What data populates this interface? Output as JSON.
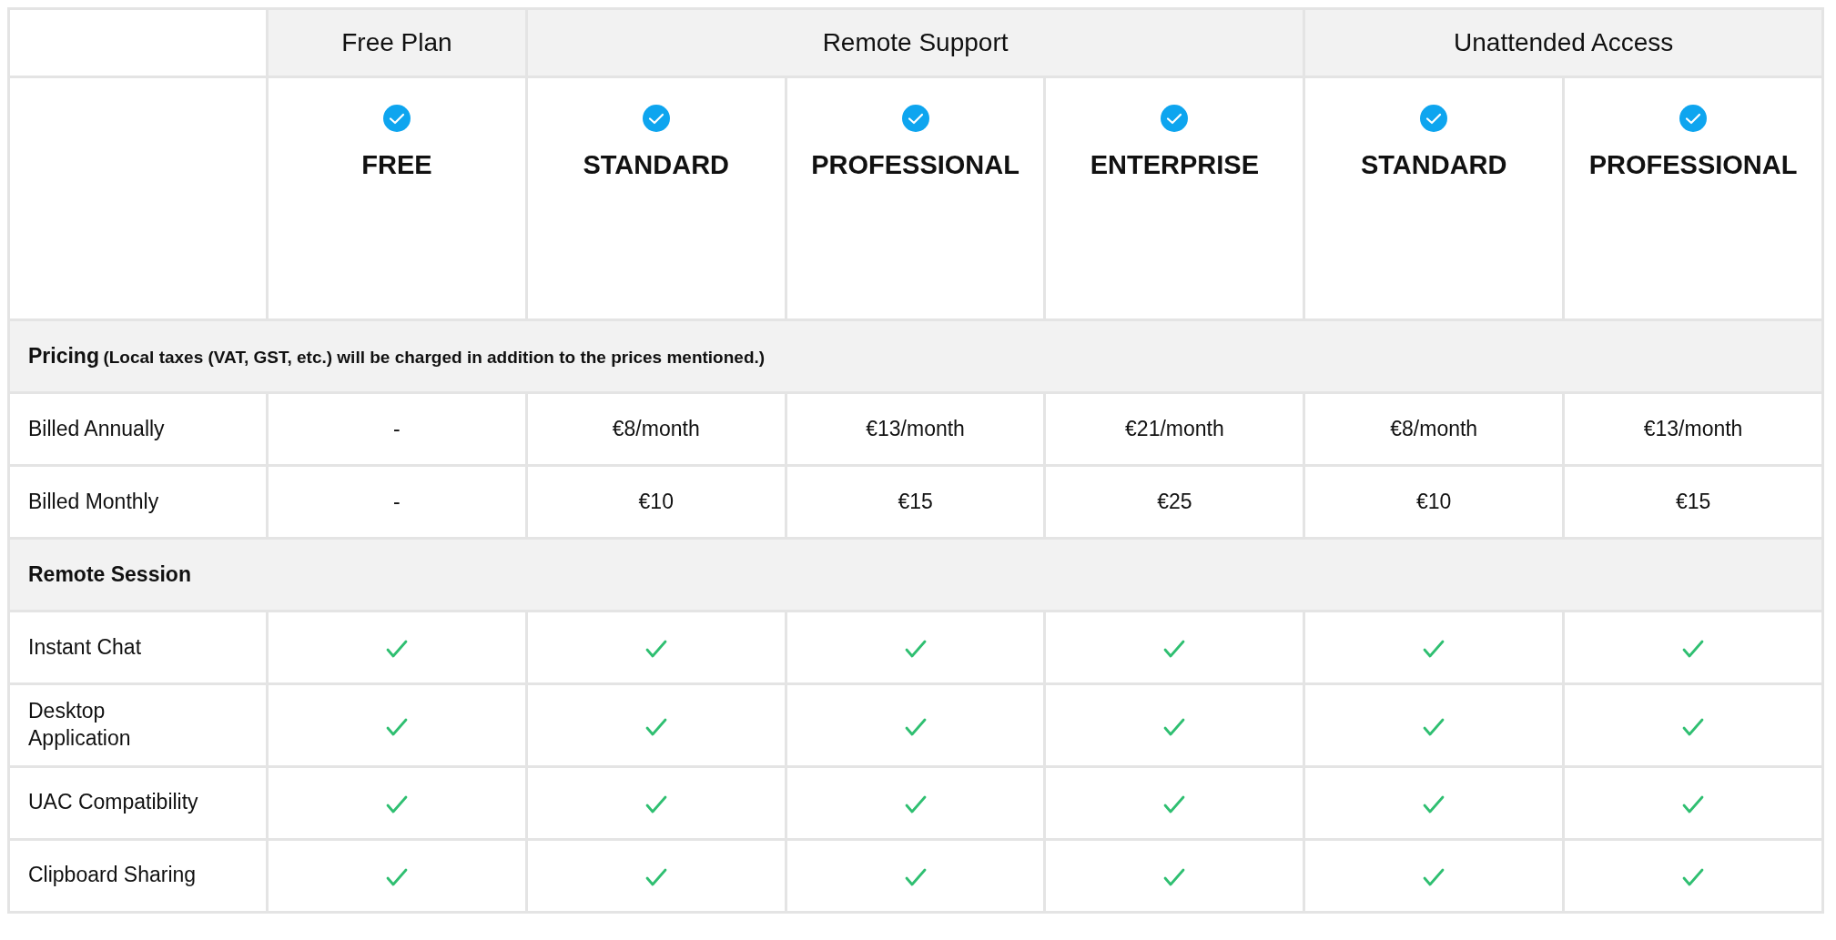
{
  "groups": [
    {
      "label": "Free Plan",
      "plans": [
        {
          "name": "FREE"
        }
      ]
    },
    {
      "label": "Remote Support",
      "plans": [
        {
          "name": "STANDARD"
        },
        {
          "name": "PROFESSIONAL"
        },
        {
          "name": "ENTERPRISE"
        }
      ]
    },
    {
      "label": "Unattended Access",
      "plans": [
        {
          "name": "STANDARD"
        },
        {
          "name": "PROFESSIONAL"
        }
      ]
    }
  ],
  "sections": [
    {
      "title": "Pricing",
      "note": "(Local taxes (VAT, GST, etc.) will be charged in addition to the prices mentioned.)",
      "rows": [
        {
          "label": "Billed Annually",
          "cells": [
            {
              "kind": "text",
              "text": "-"
            },
            {
              "kind": "text",
              "text": "€8/month"
            },
            {
              "kind": "text",
              "text": "€13/month"
            },
            {
              "kind": "text",
              "text": "€21/month"
            },
            {
              "kind": "text",
              "text": "€8/month"
            },
            {
              "kind": "text",
              "text": "€13/month"
            }
          ]
        },
        {
          "label": "Billed Monthly",
          "cells": [
            {
              "kind": "text",
              "text": "-"
            },
            {
              "kind": "text",
              "text": "€10"
            },
            {
              "kind": "text",
              "text": "€15"
            },
            {
              "kind": "text",
              "text": "€25"
            },
            {
              "kind": "text",
              "text": "€10"
            },
            {
              "kind": "text",
              "text": "€15"
            }
          ]
        }
      ]
    },
    {
      "title": "Remote Session",
      "rows": [
        {
          "label": "Instant Chat",
          "cells": [
            {
              "kind": "check"
            },
            {
              "kind": "check"
            },
            {
              "kind": "check"
            },
            {
              "kind": "check"
            },
            {
              "kind": "check"
            },
            {
              "kind": "check"
            }
          ]
        },
        {
          "label": "Desktop Application",
          "cells": [
            {
              "kind": "check"
            },
            {
              "kind": "check"
            },
            {
              "kind": "check"
            },
            {
              "kind": "check"
            },
            {
              "kind": "check"
            },
            {
              "kind": "check"
            }
          ]
        },
        {
          "label": "UAC Compatibility",
          "cells": [
            {
              "kind": "check"
            },
            {
              "kind": "check"
            },
            {
              "kind": "check"
            },
            {
              "kind": "check"
            },
            {
              "kind": "check"
            },
            {
              "kind": "check"
            }
          ]
        },
        {
          "label": "Clipboard Sharing",
          "cells": [
            {
              "kind": "check"
            },
            {
              "kind": "check"
            },
            {
              "kind": "check"
            },
            {
              "kind": "check"
            },
            {
              "kind": "check"
            },
            {
              "kind": "check"
            }
          ]
        }
      ]
    }
  ]
}
